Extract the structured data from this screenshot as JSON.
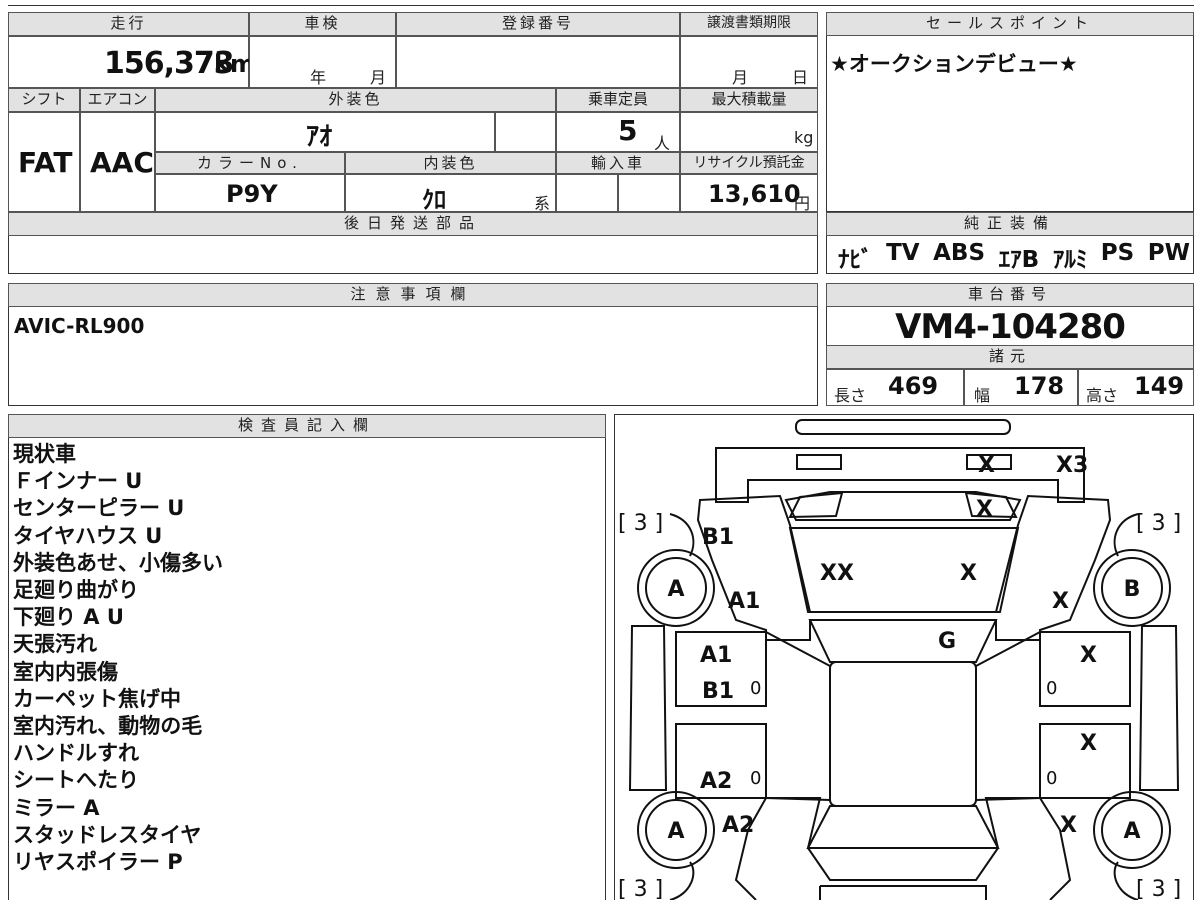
{
  "vehicle": {
    "mileage_label": "走行",
    "mileage": "156,373",
    "mileage_unit": "km",
    "shaken_label": "車検",
    "shaken_year": "年",
    "shaken_month": "月",
    "reg_label": "登録番号",
    "transfer_label": "譲渡書類期限",
    "transfer_month": "月",
    "transfer_day": "日",
    "shift_label": "シフト",
    "shift": "FAT",
    "ac_label": "エアコン",
    "ac": "AAC",
    "ext_color_label": "外装色",
    "ext_color": "ｱｵ",
    "capacity_label": "乗車定員",
    "capacity": "5",
    "capacity_unit": "人",
    "max_load_label": "最大積載量",
    "max_load_unit": "kg",
    "color_no_label": "カラーNo.",
    "color_no": "P9Y",
    "int_color_label": "内装色",
    "int_color": "ｸﾛ",
    "int_color_suffix": "系",
    "import_label": "輸入車",
    "recycle_label": "リサイクル預託金",
    "recycle": "13,610",
    "recycle_unit": "円",
    "later_parts_label": "後日発送部品"
  },
  "sales": {
    "label": "セールスポイント",
    "text": "★オークションデビュー★"
  },
  "equipment": {
    "label": "純正装備",
    "items": [
      "ﾅﾋﾞ",
      "TV",
      "ABS",
      "ｴｱB",
      "ｱﾙﾐ",
      "PS",
      "PW"
    ]
  },
  "notes": {
    "label": "注意事項欄",
    "text": "AVIC-RL900"
  },
  "chassis": {
    "label": "車台番号",
    "number": "VM4-104280",
    "specs_label": "諸元",
    "length_label": "長さ",
    "length": "469",
    "width_label": "幅",
    "width": "178",
    "height_label": "高さ",
    "height": "149"
  },
  "inspector": {
    "label": "検査員記入欄",
    "lines": [
      "現状車",
      "Ｆインナー U",
      "センターピラー U",
      "タイヤハウス U",
      "外装色あせ、小傷多い",
      "足廻り曲がり",
      "下廻り A U",
      "天張汚れ",
      "室内内張傷",
      "カーペット焦げ中",
      "室内汚れ、動物の毛",
      "ハンドルすれ",
      "シートへたり",
      "ミラー A",
      "スタッドレスタイヤ",
      "リヤスポイラー P"
    ]
  },
  "diagram": {
    "marks": {
      "rear_x": "X",
      "rear_x3": "X3",
      "rear_glass_x": "X",
      "trunk_xx": "XX",
      "trunk_x": "X",
      "b1_top": "B1",
      "a1_left": "A1",
      "x_right_top": "X",
      "g_roof": "G",
      "a1_mid": "A1",
      "x_right_mid": "X",
      "b1_mid": "B1",
      "x_right_low": "X",
      "a2_mid": "A2",
      "a2_low": "A2",
      "x_right_bottom": "X",
      "zero_1": "0",
      "zero_2": "0",
      "zero_3": "0",
      "zero_4": "0",
      "tire_rl": "A",
      "tire_rr": "B",
      "tire_fl": "A",
      "tire_fr": "A",
      "bracket_tl": "[ 3 ]",
      "bracket_tr": "[ 3 ]",
      "bracket_bl": "[ 3 ]",
      "bracket_br": "[ 3 ]"
    }
  }
}
